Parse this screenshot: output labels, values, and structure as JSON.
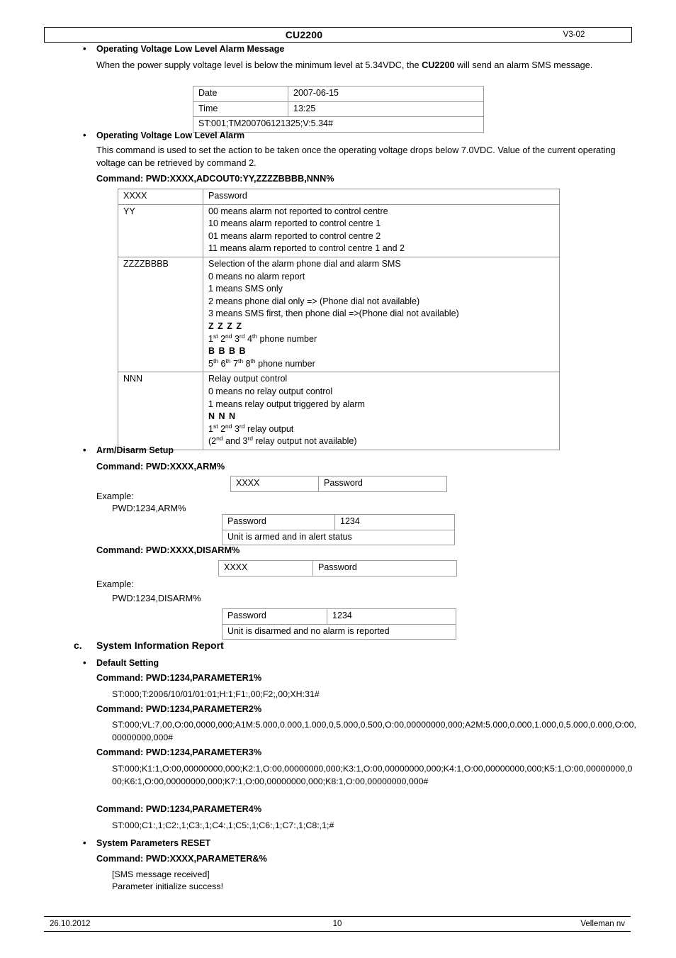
{
  "header": {
    "title": "CU2200",
    "version": "V3-02"
  },
  "footer": {
    "date": "26.10.2012",
    "page_number": "10",
    "company": "Velleman nv"
  },
  "sections": {
    "alarm_message": {
      "heading": "Operating Voltage Low Level Alarm Message",
      "body_part1": "When the power supply voltage level is below the minimum level at 5.34VDC, the ",
      "body_bold": "CU2200",
      "body_part2": " will send an alarm SMS message.",
      "table": {
        "rows": [
          {
            "label": "Date",
            "value": "2007-06-15"
          },
          {
            "label": "Time",
            "value": "13:25"
          }
        ],
        "full_row": "ST:001;TM200706121325;V:5.34#"
      }
    },
    "alarm_setup": {
      "heading": "Operating Voltage Low Level Alarm",
      "body_line1": "This command is used to set the action to be taken once the operating voltage drops below 7.0VDC.",
      "body_line2": "Value of the current operating voltage can be retrieved by command 2.",
      "command": "Command: PWD:XXXX,ADCOUT0:YY,ZZZZBBBB,NNN%",
      "params": {
        "xxxx_key": "XXXX",
        "xxxx_val": "Password",
        "yy_key": "YY",
        "yy_lines": [
          "00 means alarm not reported to control centre",
          "10 means alarm reported to control centre 1",
          "01 means alarm reported to control centre 2",
          "11 means alarm reported to control centre 1 and 2"
        ],
        "zzzz_key": "ZZZZBBBB",
        "zzzz_lines": [
          "Selection of the alarm phone dial and alarm SMS",
          "0 means no alarm report",
          "1 means SMS only",
          "2 means phone dial only => (Phone dial not available)",
          "3 means SMS first, then phone dial =>(Phone dial not available)"
        ],
        "zzzz_z_row": "Z  Z  Z  Z",
        "zzzz_z_ord": [
          "1",
          "st",
          "2",
          "nd",
          "3",
          "rd",
          "4",
          "th"
        ],
        "zzzz_z_tail": " phone number",
        "zzzz_b_row": "B  B  B  B",
        "zzzz_b_ord": [
          "5",
          "th",
          "6",
          "th",
          "7",
          "th",
          "8",
          "th"
        ],
        "zzzz_b_tail": " phone number",
        "nnn_key": "NNN",
        "nnn_lines": [
          "Relay output control",
          "0 means no relay output control",
          "1 means relay output triggered by alarm"
        ],
        "nnn_n_row": "N  N  N",
        "nnn_n_ord": [
          "1",
          "st",
          "2",
          "nd",
          "3",
          "rd"
        ],
        "nnn_n_tail": " relay output",
        "nnn_note_a": "(2",
        "nnn_note_a_sup": "nd",
        "nnn_note_b": " and 3",
        "nnn_note_b_sup": "rd",
        "nnn_note_c": " relay output not available)"
      }
    },
    "arm_disarm": {
      "heading": "Arm/Disarm Setup",
      "arm_command": "Command: PWD:XXXX,ARM%",
      "arm_table": {
        "key": "XXXX",
        "value": "Password"
      },
      "arm_example_label": "Example:",
      "arm_example_value": "PWD:1234,ARM%",
      "arm_result": {
        "key": "Password",
        "value": "1234",
        "status": "Unit is armed and in alert status"
      },
      "disarm_command": "Command: PWD:XXXX,DISARM%",
      "disarm_table": {
        "key": "XXXX",
        "value": "Password"
      },
      "disarm_example_label": "Example:",
      "disarm_example_value": "PWD:1234,DISARM%",
      "disarm_result": {
        "key": "Password",
        "value": "1234",
        "status": "Unit is disarmed and no alarm is reported"
      }
    },
    "system_info": {
      "letter": "c.",
      "heading": "System Information Report",
      "default_setting_heading": "Default Setting",
      "parameter1_command": "Command: PWD:1234,PARAMETER1%",
      "parameter1_value": "ST:000;T:2006/10/01/01:01;H:1;F1:,00;F2;,00;XH:31#",
      "parameter2_command": "Command: PWD:1234,PARAMETER2%",
      "parameter2_value": "ST:000;VL:7.00,O:00,0000,000;A1M:5.000,0.000,1.000,0,5.000,0.500,O:00,00000000,000;A2M:5.000,0.000,1.000,0,5.000,0.000,O:00,00000000,000#",
      "parameter3_command": "Command: PWD:1234,PARAMETER3%",
      "parameter3_value": "ST:000;K1:1,O:00,00000000,000;K2:1,O:00,00000000,000;K3:1,O:00,00000000,000;K4:1,O:00,00000000,000;K5:1,O:00,00000000,000;K6:1,O:00,00000000,000;K7:1,O:00,00000000,000;K8:1,O:00,00000000,000#",
      "parameter4_command": "Command: PWD:1234,PARAMETER4%",
      "parameter4_value": "ST:000;C1:,1;C2:,1;C3:,1;C4:,1;C5:,1;C6:,1;C7:,1;C8:,1;#",
      "reset_heading": "System Parameters RESET",
      "reset_command": "Command: PWD:XXXX,PARAMETER&%",
      "reset_sms_label": "[SMS message received]",
      "reset_sms_text": "Parameter initialize success!"
    }
  }
}
